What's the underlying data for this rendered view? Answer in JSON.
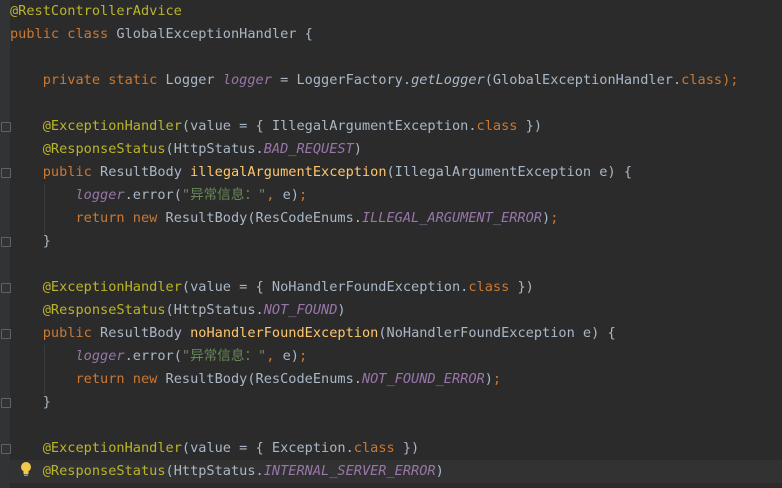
{
  "colors": {
    "background": "#2b2b2b",
    "annotation": "#bbb529",
    "keyword": "#cc7832",
    "field": "#9876aa",
    "method": "#ffc66d",
    "string": "#6a8759",
    "plain": "#a9b7c6"
  },
  "icons": {
    "bulb": "lightbulb-intention-icon",
    "fold": "fold-marker-icon"
  },
  "lines": [
    [
      {
        "t": "@RestControllerAdvice",
        "c": "ann"
      }
    ],
    [
      {
        "t": "public class ",
        "c": "kw"
      },
      {
        "t": "GlobalExceptionHandler {",
        "c": "pln"
      }
    ],
    [],
    [
      {
        "t": "    "
      },
      {
        "t": "private static ",
        "c": "kw"
      },
      {
        "t": "Logger ",
        "c": "pln"
      },
      {
        "t": "logger",
        "c": "fld"
      },
      {
        "t": " = LoggerFactory.",
        "c": "pln"
      },
      {
        "t": "getLogger",
        "c": "mthi"
      },
      {
        "t": "(GlobalExceptionHandler.",
        "c": "pln"
      },
      {
        "t": "class",
        "c": "kw"
      },
      {
        "t": ");",
        "c": "kw"
      }
    ],
    [],
    [
      {
        "t": "    "
      },
      {
        "t": "@ExceptionHandler",
        "c": "ann"
      },
      {
        "t": "(value = { IllegalArgumentException.",
        "c": "pln"
      },
      {
        "t": "class",
        "c": "kw"
      },
      {
        "t": " })",
        "c": "pln"
      }
    ],
    [
      {
        "t": "    "
      },
      {
        "t": "@ResponseStatus",
        "c": "ann"
      },
      {
        "t": "(HttpStatus.",
        "c": "pln"
      },
      {
        "t": "BAD_REQUEST",
        "c": "fld"
      },
      {
        "t": ")",
        "c": "pln"
      }
    ],
    [
      {
        "t": "    "
      },
      {
        "t": "public ",
        "c": "kw"
      },
      {
        "t": "ResultBody ",
        "c": "pln"
      },
      {
        "t": "illegalArgumentException",
        "c": "mth"
      },
      {
        "t": "(IllegalArgumentException e) {",
        "c": "pln"
      }
    ],
    [
      {
        "t": "        "
      },
      {
        "t": "logger",
        "c": "fld"
      },
      {
        "t": ".error(",
        "c": "pln"
      },
      {
        "t": "\"异常信息：\"",
        "c": "str"
      },
      {
        "t": ", ",
        "c": "kw"
      },
      {
        "t": "e)",
        "c": "pln"
      },
      {
        "t": ";",
        "c": "kw"
      }
    ],
    [
      {
        "t": "        "
      },
      {
        "t": "return new ",
        "c": "kw"
      },
      {
        "t": "ResultBody(ResCodeEnums.",
        "c": "pln"
      },
      {
        "t": "ILLEGAL_ARGUMENT_ERROR",
        "c": "fld"
      },
      {
        "t": ")",
        "c": "pln"
      },
      {
        "t": ";",
        "c": "kw"
      }
    ],
    [
      {
        "t": "    }",
        "c": "pln"
      }
    ],
    [],
    [
      {
        "t": "    "
      },
      {
        "t": "@ExceptionHandler",
        "c": "ann"
      },
      {
        "t": "(value = { NoHandlerFoundException.",
        "c": "pln"
      },
      {
        "t": "class",
        "c": "kw"
      },
      {
        "t": " })",
        "c": "pln"
      }
    ],
    [
      {
        "t": "    "
      },
      {
        "t": "@ResponseStatus",
        "c": "ann"
      },
      {
        "t": "(HttpStatus.",
        "c": "pln"
      },
      {
        "t": "NOT_FOUND",
        "c": "fld"
      },
      {
        "t": ")",
        "c": "pln"
      }
    ],
    [
      {
        "t": "    "
      },
      {
        "t": "public ",
        "c": "kw"
      },
      {
        "t": "ResultBody ",
        "c": "pln"
      },
      {
        "t": "noHandlerFoundException",
        "c": "mth"
      },
      {
        "t": "(NoHandlerFoundException e) {",
        "c": "pln"
      }
    ],
    [
      {
        "t": "        "
      },
      {
        "t": "logger",
        "c": "fld"
      },
      {
        "t": ".error(",
        "c": "pln"
      },
      {
        "t": "\"异常信息：\"",
        "c": "str"
      },
      {
        "t": ", ",
        "c": "kw"
      },
      {
        "t": "e)",
        "c": "pln"
      },
      {
        "t": ";",
        "c": "kw"
      }
    ],
    [
      {
        "t": "        "
      },
      {
        "t": "return new ",
        "c": "kw"
      },
      {
        "t": "ResultBody(ResCodeEnums.",
        "c": "pln"
      },
      {
        "t": "NOT_FOUND_ERROR",
        "c": "fld"
      },
      {
        "t": ")",
        "c": "pln"
      },
      {
        "t": ";",
        "c": "kw"
      }
    ],
    [
      {
        "t": "    }",
        "c": "pln"
      }
    ],
    [],
    [
      {
        "t": "    "
      },
      {
        "t": "@ExceptionHandler",
        "c": "ann"
      },
      {
        "t": "(value = { Exception.",
        "c": "pln"
      },
      {
        "t": "class",
        "c": "kw"
      },
      {
        "t": " })",
        "c": "pln"
      }
    ],
    [
      {
        "t": "    "
      },
      {
        "t": "@ResponseStatus",
        "c": "ann"
      },
      {
        "t": "(HttpStatus.",
        "c": "pln"
      },
      {
        "t": "INTERNAL_SERVER_ERROR",
        "c": "fld"
      },
      {
        "t": ")",
        "c": "pln"
      }
    ]
  ]
}
